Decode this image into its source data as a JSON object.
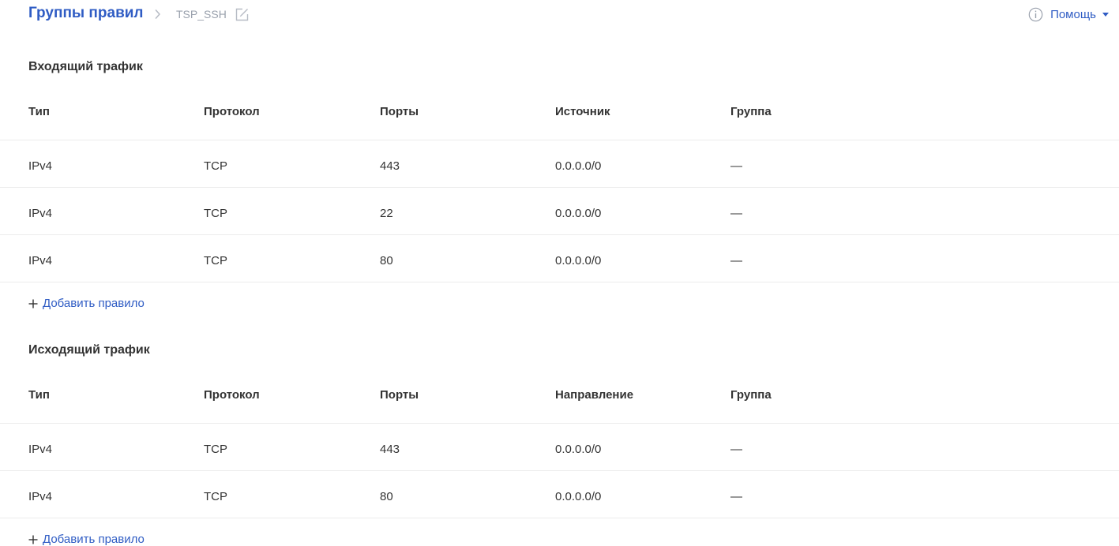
{
  "breadcrumb": {
    "root": "Группы правил",
    "current": "TSP_SSH"
  },
  "help": {
    "label": "Помощь"
  },
  "colors": {
    "accent": "#2f5cc4",
    "muted": "#9aa1ad",
    "text": "#333333",
    "divider": "#ececec"
  },
  "inbound": {
    "title": "Входящий трафик",
    "columns": [
      "Тип",
      "Протокол",
      "Порты",
      "Источник",
      "Группа"
    ],
    "rows": [
      [
        "IPv4",
        "TCP",
        "443",
        "0.0.0.0/0",
        "—"
      ],
      [
        "IPv4",
        "TCP",
        "22",
        "0.0.0.0/0",
        "—"
      ],
      [
        "IPv4",
        "TCP",
        "80",
        "0.0.0.0/0",
        "—"
      ]
    ],
    "add_label": "Добавить правило"
  },
  "outbound": {
    "title": "Исходящий трафик",
    "columns": [
      "Тип",
      "Протокол",
      "Порты",
      "Направление",
      "Группа"
    ],
    "rows": [
      [
        "IPv4",
        "TCP",
        "443",
        "0.0.0.0/0",
        "—"
      ],
      [
        "IPv4",
        "TCP",
        "80",
        "0.0.0.0/0",
        "—"
      ]
    ],
    "add_label": "Добавить правило"
  },
  "icons": {
    "breadcrumb_separator": "chevron-right-icon",
    "edit": "edit-icon",
    "help": "info-icon",
    "help_caret": "caret-down-icon",
    "add": "plus-icon"
  }
}
